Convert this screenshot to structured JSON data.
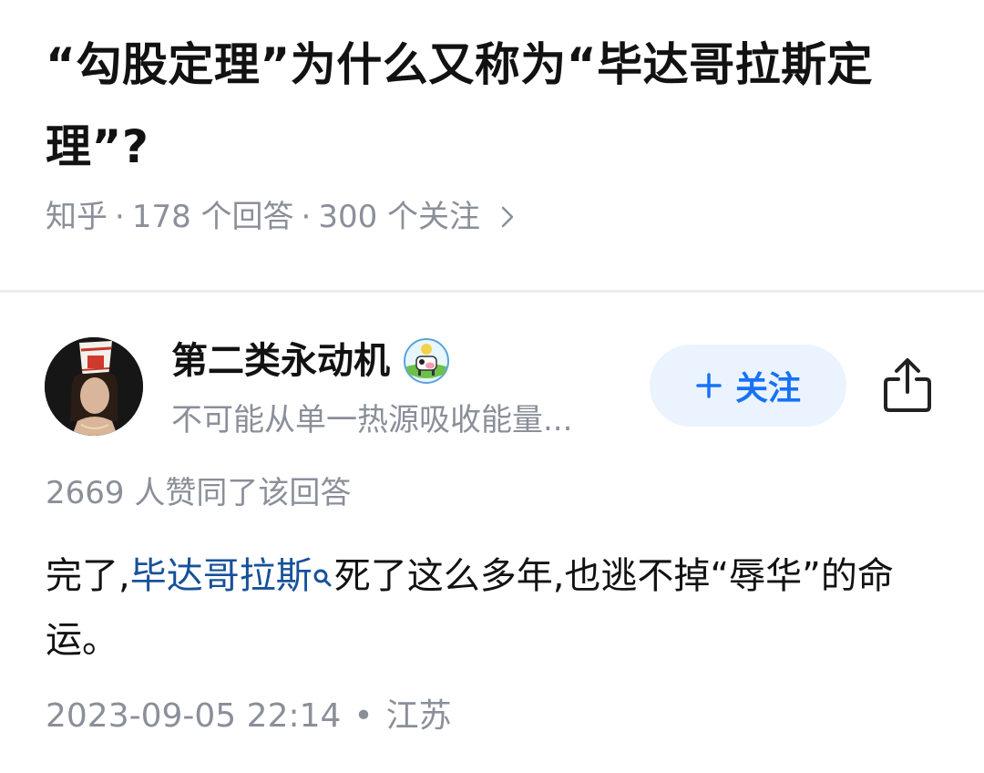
{
  "question": {
    "title": "“勾股定理”为什么又称为“毕达哥拉斯定理”?",
    "source": "知乎",
    "answer_count": "178 个回答",
    "follower_count": "300 个关注",
    "separator": "·"
  },
  "author": {
    "name": "第二类永动机",
    "bio": "不可能从单一热源吸收能量...",
    "avatar_icon": "avatar-photo",
    "badge_icon": "cow-badge-icon"
  },
  "actions": {
    "follow_plus": "+",
    "follow_label": "关注",
    "share_icon": "share-icon"
  },
  "answer": {
    "votes": "2669 人赞同了该回答",
    "text_before_link": "完了,",
    "link_text": "毕达哥拉斯",
    "text_after_link": "死了这么多年,也逃不掉“辱华”的命运。",
    "date": "2023-09-05 22:14",
    "dot": "•",
    "location": "江苏"
  },
  "colors": {
    "accent": "#1772f6",
    "follow_bg": "#ebf3ff",
    "link": "#175199",
    "meta_text": "#8a8f99"
  }
}
